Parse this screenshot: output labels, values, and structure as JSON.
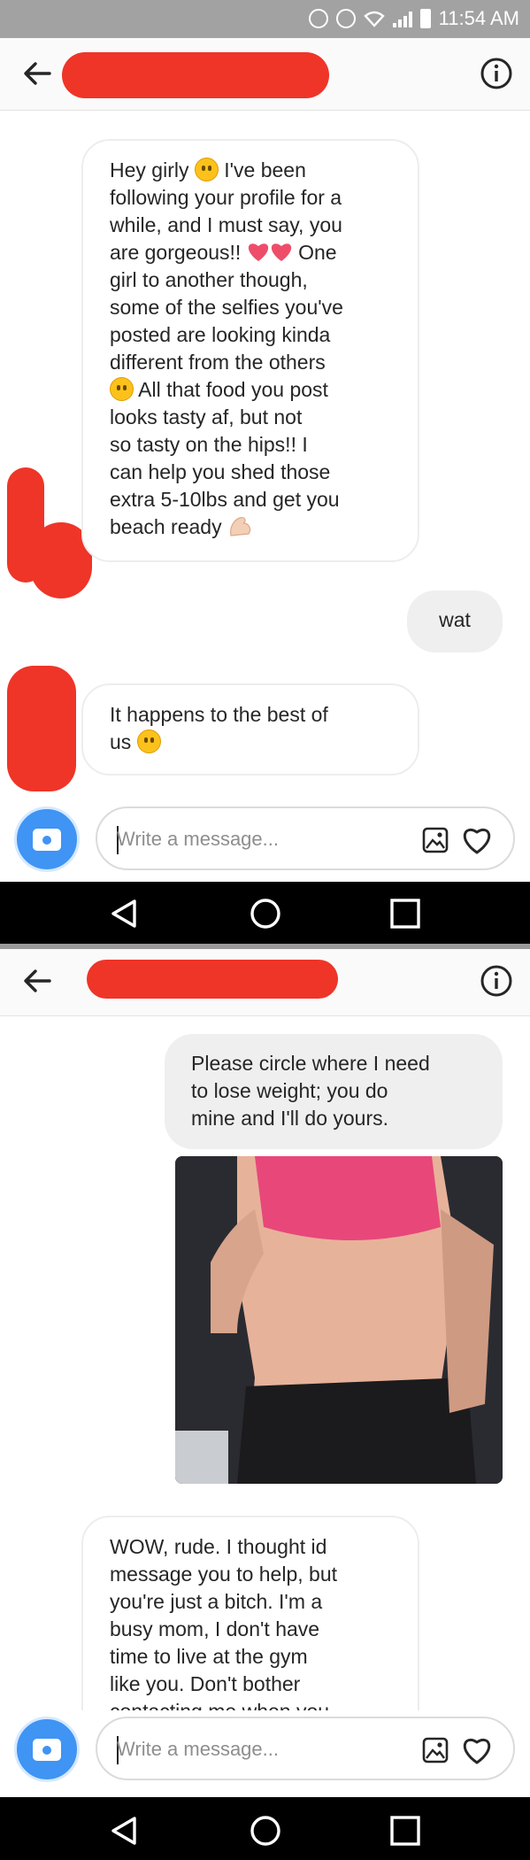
{
  "status_bar": {
    "time": "11:54 AM"
  },
  "colors": {
    "accent": "#3f94f4",
    "redaction": "#ee3528",
    "emoji": "#fcc21b",
    "heart": "#ee4d6a"
  },
  "icons": [
    "back-arrow-icon",
    "info-icon",
    "camera-icon",
    "gallery-icon",
    "heart-icon",
    "nav-back-icon",
    "nav-home-icon",
    "nav-recents-icon"
  ],
  "screen1": {
    "messages": [
      {
        "from": "them",
        "line1": "Hey girly",
        "line1_tail": " I've been",
        "line2": "following your profile for a",
        "line3": "while, and I must say, you",
        "line4": "are gorgeous!!",
        "line4_tail": " One",
        "line5": "girl to another though,",
        "line6": "some of the selfies you've",
        "line7": "posted are looking kinda",
        "line8": "different from the others",
        "line9_tail": " All that food you post",
        "line10": "looks tasty af, but not",
        "line11": "so tasty on the hips!! I",
        "line12": "can help you shed those",
        "line13": "extra 5-10lbs and get you",
        "line14": "beach ready"
      },
      {
        "from": "me",
        "text": "wat"
      },
      {
        "from": "them",
        "line1": "It happens to the best of",
        "line2": "us"
      }
    ],
    "composer": {
      "placeholder": "Write a message..."
    }
  },
  "screen2": {
    "messages": [
      {
        "from": "me",
        "line1": "Please circle where I need",
        "line2": "to lose weight; you do",
        "line3": "mine and I'll do yours."
      },
      {
        "from": "me",
        "type": "photo"
      },
      {
        "from": "them",
        "line1": "WOW, rude. I thought id",
        "line2": "message you to help, but",
        "line3": "you're just a bitch. I'm a",
        "line4": "busy mom, I don't have",
        "line5": "time to live at the gym",
        "line6": "like you. Don't bother",
        "line7": "contacting me when you"
      }
    ],
    "composer": {
      "placeholder": "Write a message..."
    }
  }
}
